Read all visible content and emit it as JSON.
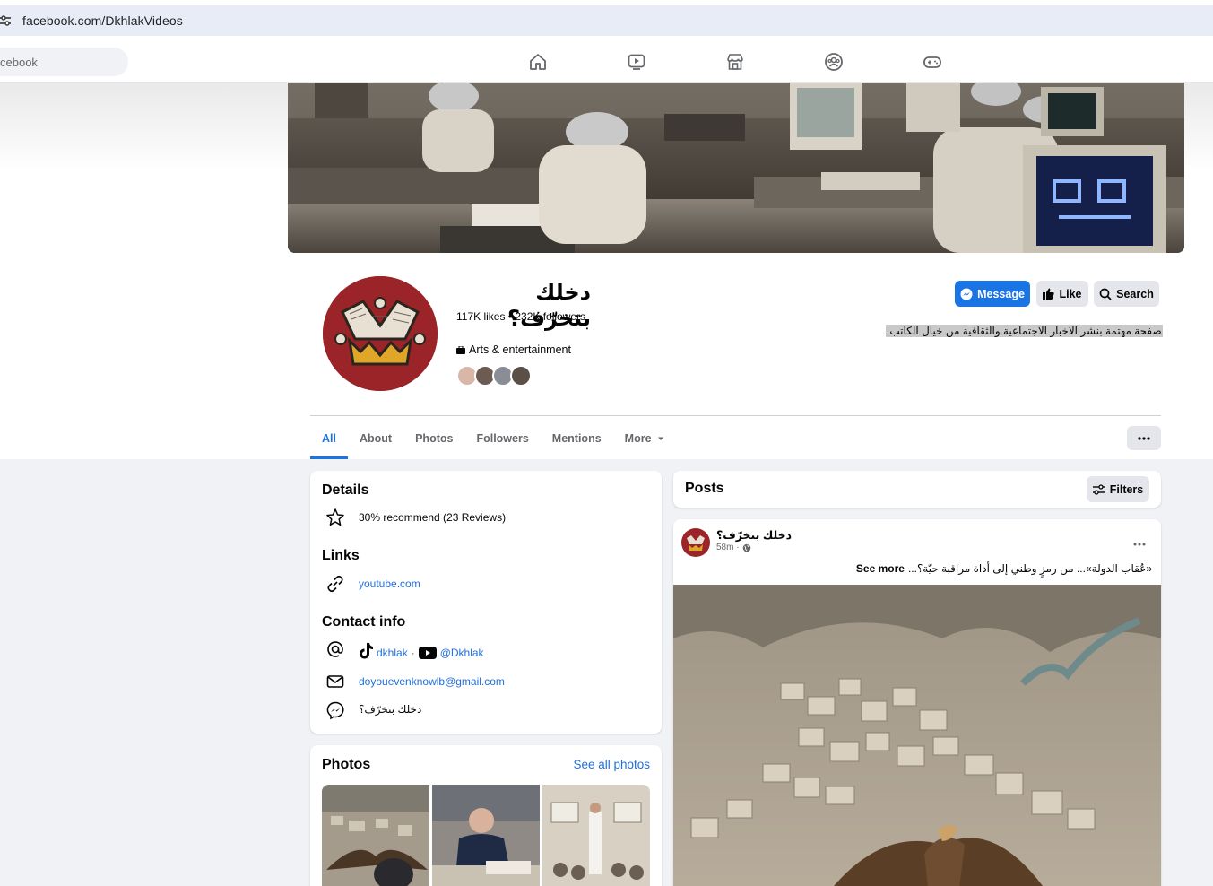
{
  "browser": {
    "url": "facebook.com/DkhlakVideos"
  },
  "fbnav": {
    "search_placeholder": "cebook",
    "icons": [
      "home-icon",
      "video-icon",
      "marketplace-icon",
      "groups-icon",
      "gaming-icon"
    ]
  },
  "profile": {
    "name": "دخلك بتخرّف؟",
    "stats": "117K likes • 232K followers",
    "category": "Arts & entertainment",
    "bio": "صفحة مهتمة بنشر الاخبار الاجتماعية والثقافية من خيال الكاتب."
  },
  "actions": {
    "message": "Message",
    "like": "Like",
    "search": "Search"
  },
  "tabs": [
    "All",
    "About",
    "Photos",
    "Followers",
    "Mentions",
    "More"
  ],
  "details": {
    "title": "Details",
    "recommend": "30% recommend (23 Reviews)",
    "links_title": "Links",
    "link": "youtube.com",
    "contact_title": "Contact info",
    "tiktok": "dkhlak",
    "separator": "·",
    "youtube": "@Dkhlak",
    "email": "doyouevenknowlb@gmail.com",
    "messenger": "دخلك بتخرّف؟"
  },
  "photos": {
    "title": "Photos",
    "see_all": "See all photos"
  },
  "posts": {
    "title": "Posts",
    "filters": "Filters",
    "post_author": "دخلك بتخرّف؟",
    "post_time": "58m ·",
    "post_text": "«عُقاب الدولة»... من رمزٍ وطني إلى أداة مراقبة حيّة؟...",
    "see_more": "See more"
  },
  "colors": {
    "accent": "#1b74e4",
    "avatar_bg": "#9a2428",
    "bg": "#f0f2f5"
  }
}
